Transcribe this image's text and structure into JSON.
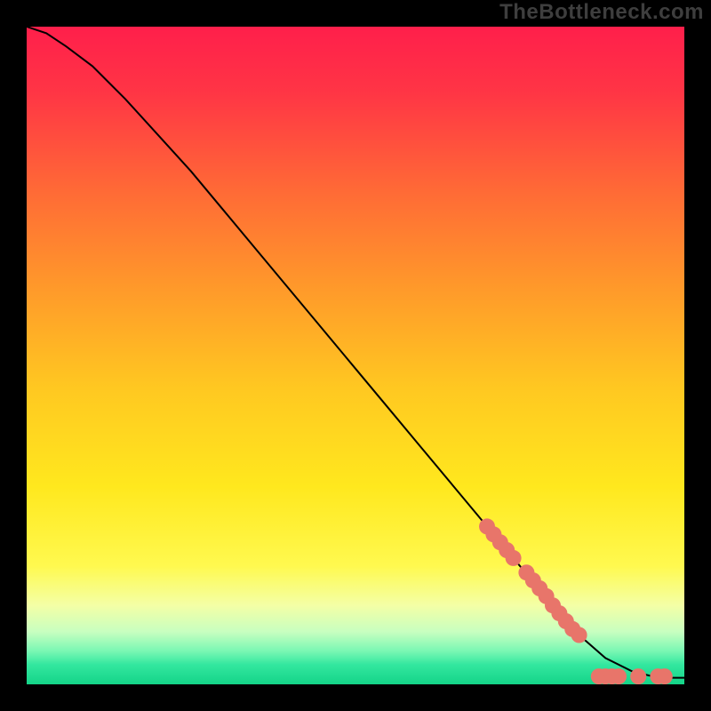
{
  "watermark": "TheBottleneck.com",
  "chart_data": {
    "type": "line",
    "title": "",
    "xlabel": "",
    "ylabel": "",
    "xlim": [
      0,
      100
    ],
    "ylim": [
      0,
      100
    ],
    "grid": false,
    "background": "rainbow-vertical",
    "series": [
      {
        "name": "bottleneck-curve",
        "type": "line",
        "color": "#000000",
        "x": [
          0,
          3,
          6,
          10,
          15,
          20,
          25,
          30,
          35,
          40,
          45,
          50,
          55,
          60,
          65,
          70,
          75,
          80,
          84,
          88,
          92,
          96,
          100
        ],
        "y": [
          100,
          99,
          97,
          94,
          89,
          83.5,
          78,
          72,
          66,
          60,
          54,
          48,
          42,
          36,
          30,
          24,
          18,
          12,
          7.5,
          4,
          2,
          1,
          1
        ]
      },
      {
        "name": "highlight-points",
        "type": "scatter",
        "color": "#e8756a",
        "x": [
          70,
          71,
          72,
          73,
          74,
          76,
          77,
          78,
          79,
          80,
          81,
          82,
          83,
          84,
          87,
          88,
          89,
          90,
          93,
          96,
          97
        ],
        "y": [
          24,
          22.8,
          21.6,
          20.4,
          19.2,
          17,
          15.8,
          14.6,
          13.4,
          12,
          10.8,
          9.6,
          8.4,
          7.5,
          1.2,
          1.2,
          1.2,
          1.2,
          1.2,
          1.2,
          1.2
        ]
      }
    ]
  }
}
